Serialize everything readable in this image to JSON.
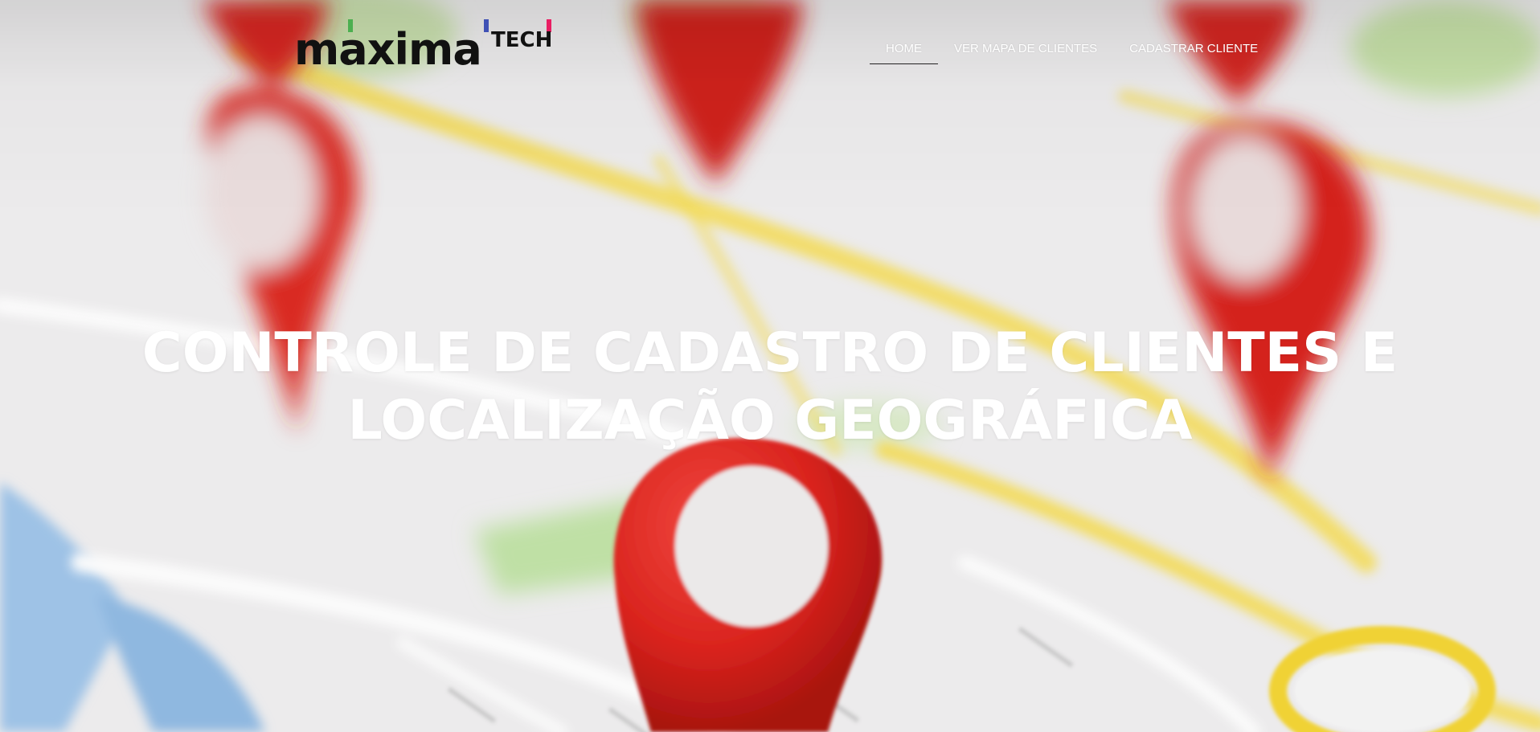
{
  "logo": {
    "name": "maxima",
    "suffix": "TECH",
    "accent_colors": [
      "#4caf50",
      "#3f51b5",
      "#e91e63"
    ]
  },
  "nav": {
    "items": [
      {
        "label": "HOME",
        "active": true
      },
      {
        "label": "VER MAPA DE CLIENTES",
        "active": false
      },
      {
        "label": "CADASTRAR CLIENTE",
        "active": false
      }
    ]
  },
  "hero": {
    "title": "CONTROLE DE CADASTRO DE CLIENTES E LOCALIZAÇÃO GEOGRÁFICA",
    "background_image": "blurred-map-with-red-location-pins"
  },
  "colors": {
    "pin_red": "#d9231d",
    "nav_text": "#ffffff",
    "title_text": "#ffffff",
    "map_road_yellow": "#f2d64b",
    "map_water_blue": "#8fb8e0",
    "map_park_green": "#bfe0a5"
  }
}
